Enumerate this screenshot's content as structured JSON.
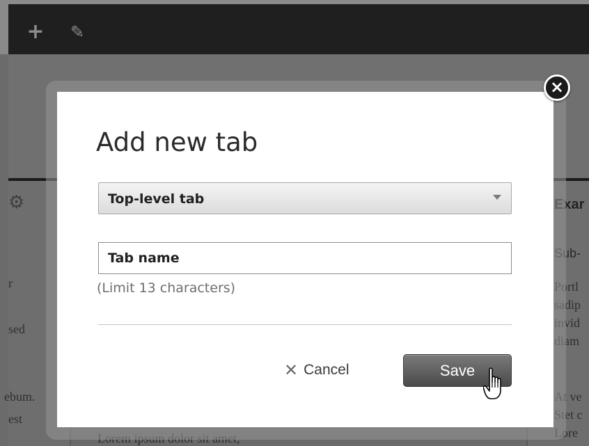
{
  "toolbar": {
    "add_icon": "plus-icon",
    "edit_icon": "pencil-icon"
  },
  "background": {
    "left_fragments": [
      "r",
      "sed",
      "ebum.",
      "est"
    ],
    "bottom_text": "Lorem ipsum dolor sit amet,",
    "right_heading": "Exar",
    "right_subheading": "Sub-",
    "right_fragments": [
      "Portl",
      "sadip",
      "invid",
      "diam",
      "At ve",
      "Stet c",
      "Lore"
    ]
  },
  "modal": {
    "title": "Add new tab",
    "close_label": "×",
    "select": {
      "selected_value": "Top-level tab"
    },
    "name_input": {
      "value": "Tab name"
    },
    "hint": "(Limit 13 characters)",
    "cancel_icon": "✕",
    "cancel_label": "Cancel",
    "save_label": "Save"
  }
}
